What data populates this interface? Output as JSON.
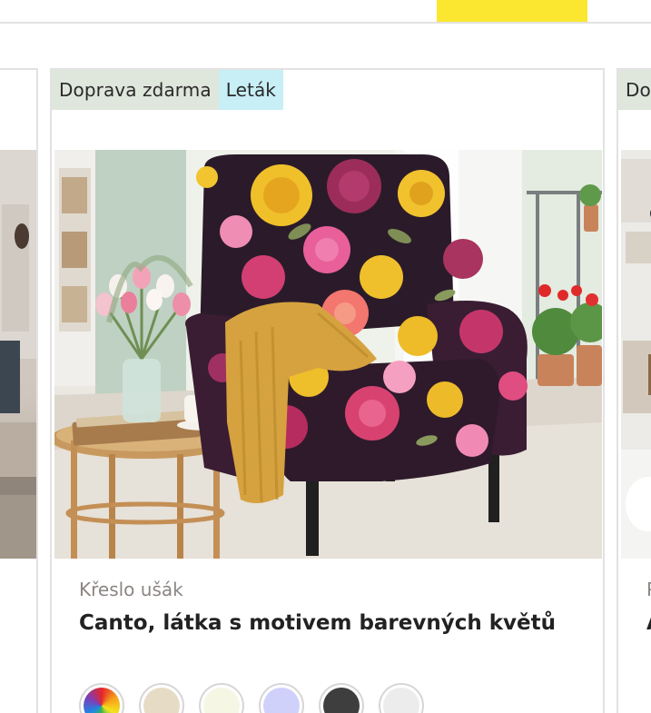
{
  "top_accent_color": "#fbe72f",
  "cards": {
    "left": {
      "badge": ""
    },
    "main": {
      "badges": [
        "Doprava zdarma",
        "Leták"
      ],
      "badge_colors": [
        "#dfe6dc",
        "#c8eef6"
      ],
      "category": "Křeslo ušák",
      "title": "Canto, látka s motivem barevných květů",
      "image_icon": "floral-armchair-photo",
      "swatches": [
        {
          "name": "multicolor",
          "color": "rainbow"
        },
        {
          "name": "beige",
          "color": "#e6dcc6"
        },
        {
          "name": "cream",
          "color": "#f5f6e4"
        },
        {
          "name": "lavender",
          "color": "#cfd1fb"
        },
        {
          "name": "anthracite",
          "color": "#3e3e3e"
        },
        {
          "name": "light-grey",
          "color": "#ececec"
        }
      ]
    },
    "right": {
      "badge": "Do",
      "category": "P",
      "title": "A"
    }
  }
}
